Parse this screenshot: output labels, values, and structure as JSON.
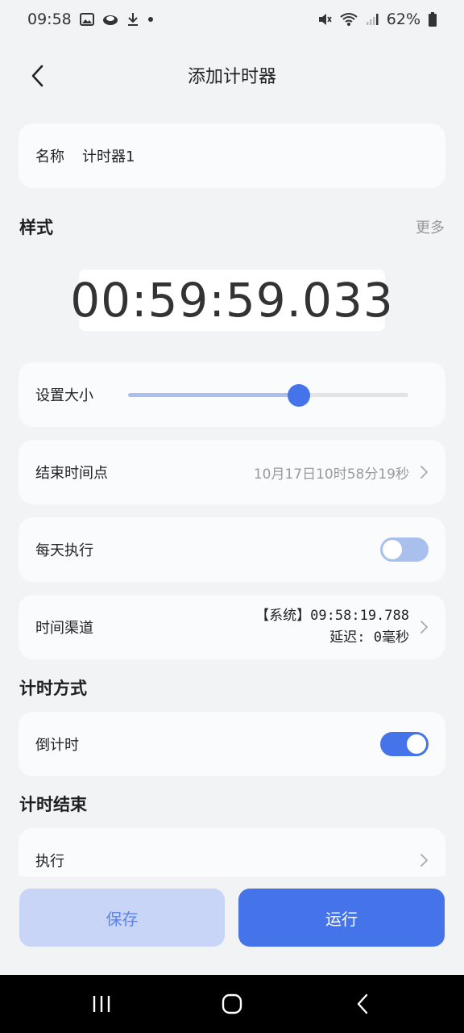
{
  "status_bar": {
    "time": "09:58",
    "battery": "62%",
    "left_icons": [
      "image-icon",
      "cloud-icon",
      "download-icon",
      "dot-icon"
    ],
    "right_icons": [
      "mute-icon",
      "wifi-icon",
      "signal-icon",
      "battery-icon"
    ]
  },
  "header": {
    "title": "添加计时器"
  },
  "name_field": {
    "label": "名称",
    "value": "计时器1"
  },
  "style_section": {
    "title": "样式",
    "more": "更多"
  },
  "timer_preview": {
    "text": "00:59:59.033"
  },
  "size_setting": {
    "label": "设置大小",
    "slider_fraction": 0.61
  },
  "end_time": {
    "label": "结束时间点",
    "value": "10月17日10时58分19秒"
  },
  "daily_repeat": {
    "label": "每天执行",
    "enabled": false
  },
  "time_channel": {
    "label": "时间渠道",
    "source": "【系统】09:58:19.788",
    "delay": "延迟: 0毫秒"
  },
  "timing_mode_section": {
    "title": "计时方式"
  },
  "countdown": {
    "label": "倒计时",
    "enabled": true
  },
  "timer_end_section": {
    "title": "计时结束"
  },
  "execute": {
    "label": "执行"
  },
  "buttons": {
    "save": "保存",
    "run": "运行"
  },
  "colors": {
    "accent": "#4574ea",
    "accent_light": "#c8d5f7",
    "background": "#f2f3f5",
    "card": "#fafbfc",
    "toggle_off": "#a9c0ee"
  }
}
